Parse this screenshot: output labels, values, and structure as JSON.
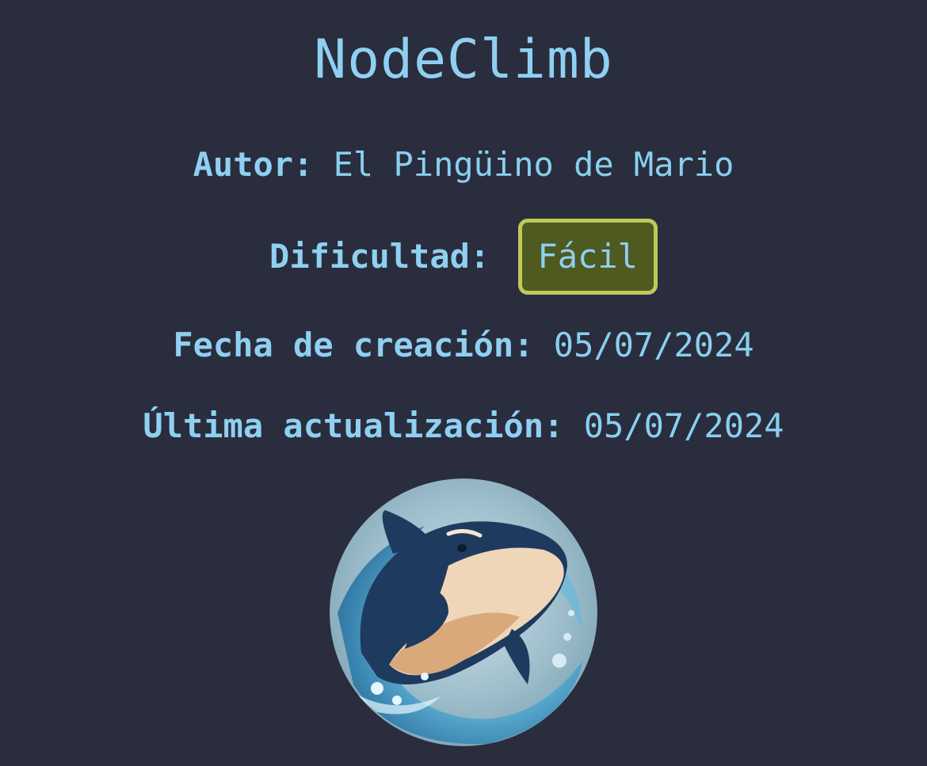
{
  "machine": {
    "name": "NodeClimb",
    "author_label": "Autor:",
    "author": "El Pingüino de Mario",
    "difficulty_label": "Dificultad:",
    "difficulty": "Fácil",
    "created_label": "Fecha de creación:",
    "created": "05/07/2024",
    "updated_label": "Última actualización:",
    "updated": "05/07/2024",
    "avatar_icon": "orca-icon"
  },
  "colors": {
    "background": "#2a2d3d",
    "text": "#8fd0f2",
    "badge_fill": "#4e5a1f",
    "badge_border": "#bfc95a"
  }
}
